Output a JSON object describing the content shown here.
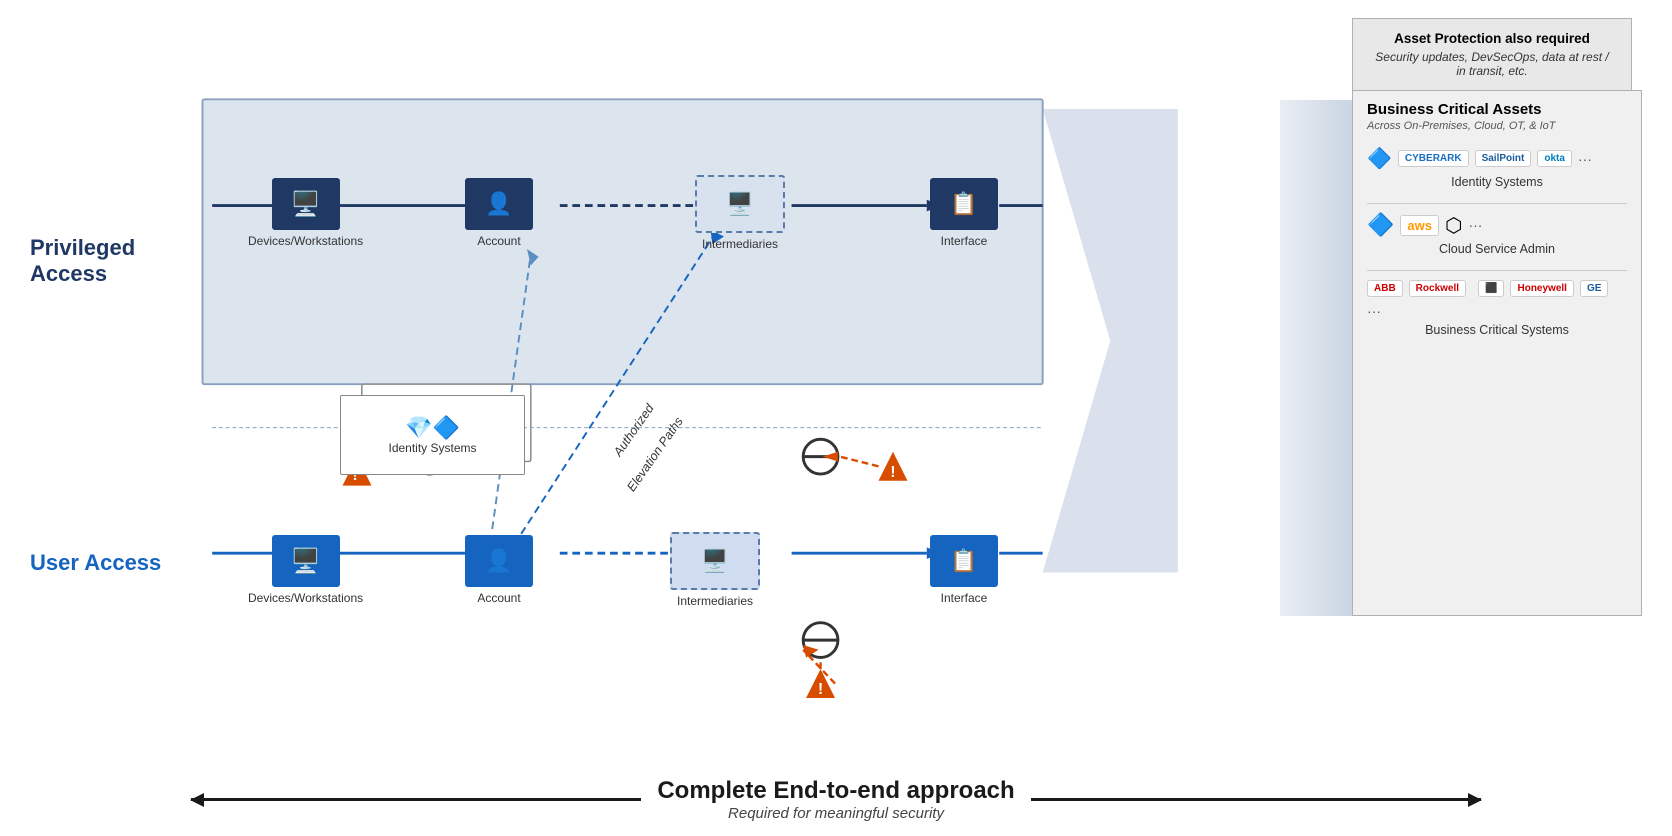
{
  "callout": {
    "title": "Asset Protection also required",
    "subtitle": "Security updates, DevSecOps, data at rest / in transit, etc."
  },
  "privileged_access": {
    "label": "Privileged Access",
    "row": {
      "device_label": "Devices/Workstations",
      "account_label": "Account",
      "intermediaries_label": "Intermediaries",
      "interface_label": "Interface"
    }
  },
  "user_access": {
    "label": "User Access",
    "row": {
      "device_label": "Devices/Workstations",
      "account_label": "Account",
      "intermediaries_label": "Intermediaries",
      "interface_label": "Interface"
    }
  },
  "identity_systems": {
    "label": "Identity Systems",
    "label2": "Identity Systems"
  },
  "authorized_elevation": {
    "label": "Authorized Elevation Paths"
  },
  "bca": {
    "title": "Business Critical Assets",
    "subtitle": "Across On-Premises, Cloud, OT, & IoT",
    "sections": [
      {
        "name": "identity-systems",
        "label": "Identity Systems",
        "logos": [
          "Ping",
          "CYBERARK",
          "SailPoint",
          "okta",
          "..."
        ]
      },
      {
        "name": "cloud-service-admin",
        "label": "Cloud Service Admin",
        "logos": [
          "Azure",
          "aws",
          "GCP",
          "..."
        ]
      },
      {
        "name": "business-critical-systems",
        "label": "Business Critical Systems",
        "logos": [
          "ABB",
          "Rockwell",
          "Honeywell",
          "GE",
          "..."
        ]
      }
    ]
  },
  "bottom": {
    "title": "Complete End-to-end approach",
    "subtitle": "Required for meaningful security"
  }
}
